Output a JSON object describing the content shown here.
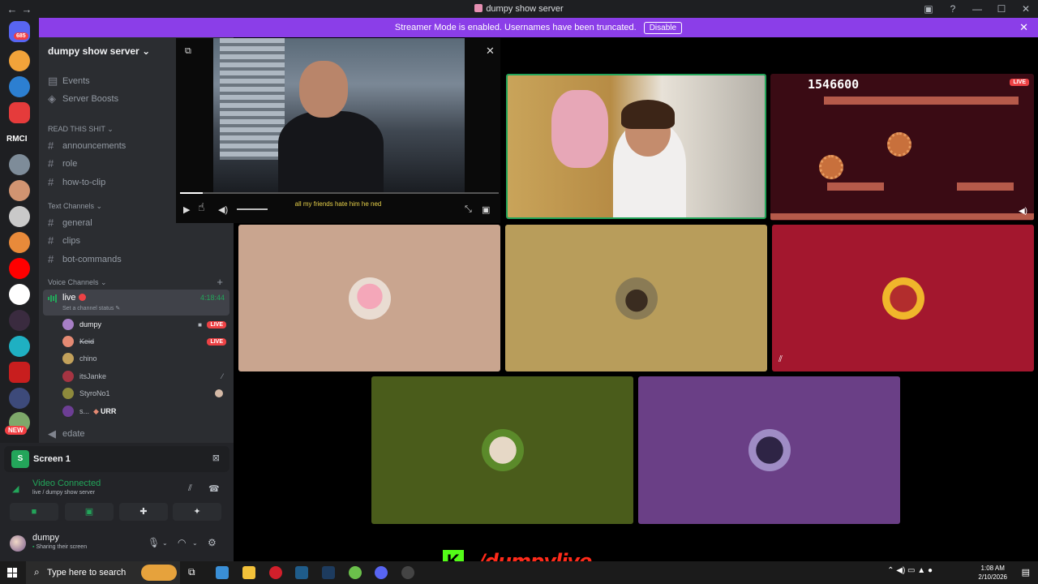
{
  "window": {
    "title": "dumpy show server"
  },
  "rail": {
    "mention_count": "685",
    "rmci_label": "RMCI",
    "new_badge": "NEW"
  },
  "banner": {
    "text": "Streamer Mode is enabled. Usernames have been truncated.",
    "button": "Disable"
  },
  "sidebar": {
    "server_name": "dumpy show server",
    "top_items": [
      {
        "label": "Events",
        "icon": "calendar-icon"
      },
      {
        "label": "Server Boosts",
        "icon": "boost-icon"
      }
    ],
    "categories": [
      {
        "name": "READ THIS SHIT",
        "channels": [
          "announcements",
          "role",
          "how-to-clip"
        ]
      },
      {
        "name": "Text Channels",
        "channels": [
          "general",
          "clips",
          "bot-commands"
        ]
      },
      {
        "name": "Voice Channels"
      }
    ],
    "voice_channel": {
      "name": "live",
      "timer": "4:18:44",
      "status_placeholder": "Set a channel status",
      "users": [
        {
          "name": "dumpy",
          "live": true,
          "camera": true,
          "color": "#a77fc6"
        },
        {
          "name": "Keid",
          "live": true,
          "camera": false,
          "color": "#e58a73"
        },
        {
          "name": "chino",
          "live": false,
          "camera": false,
          "color": "#c2a15b"
        },
        {
          "name": "itsJanke",
          "live": false,
          "camera": false,
          "muted": true,
          "color": "#a53442"
        },
        {
          "name": "StyroNo1",
          "live": false,
          "camera": false,
          "activity": true,
          "color": "#8e8a3c"
        },
        {
          "name": "s...",
          "live": false,
          "camera": false,
          "status": "URR",
          "color": "#6c3e94"
        }
      ]
    },
    "next_channel": "edate",
    "live_badge": "LIVE"
  },
  "panel": {
    "screen_label": "Screen 1",
    "connection_status": "Video Connected",
    "connection_sub": "live / dumpy show server",
    "user_name": "dumpy",
    "user_status": "Sharing their screen"
  },
  "popout": {
    "caption": "all my friends hate him he ned",
    "progress": 0.07
  },
  "stage": {
    "game_score": "1546600",
    "live_badge": "LIVE",
    "tiles": [
      {
        "color": "#c9a58f"
      },
      {
        "color": "#b89d5b"
      },
      {
        "color": "#a3172e"
      },
      {
        "color": "#4a5c1b"
      },
      {
        "color": "#6a3f86"
      }
    ]
  },
  "overlay": {
    "kick_letter": "K",
    "handle": "/dumpylive"
  },
  "taskbar": {
    "search_placeholder": "Type here to search",
    "time": "1:08 AM",
    "date": "2/10/2026",
    "notification_count": "6"
  }
}
